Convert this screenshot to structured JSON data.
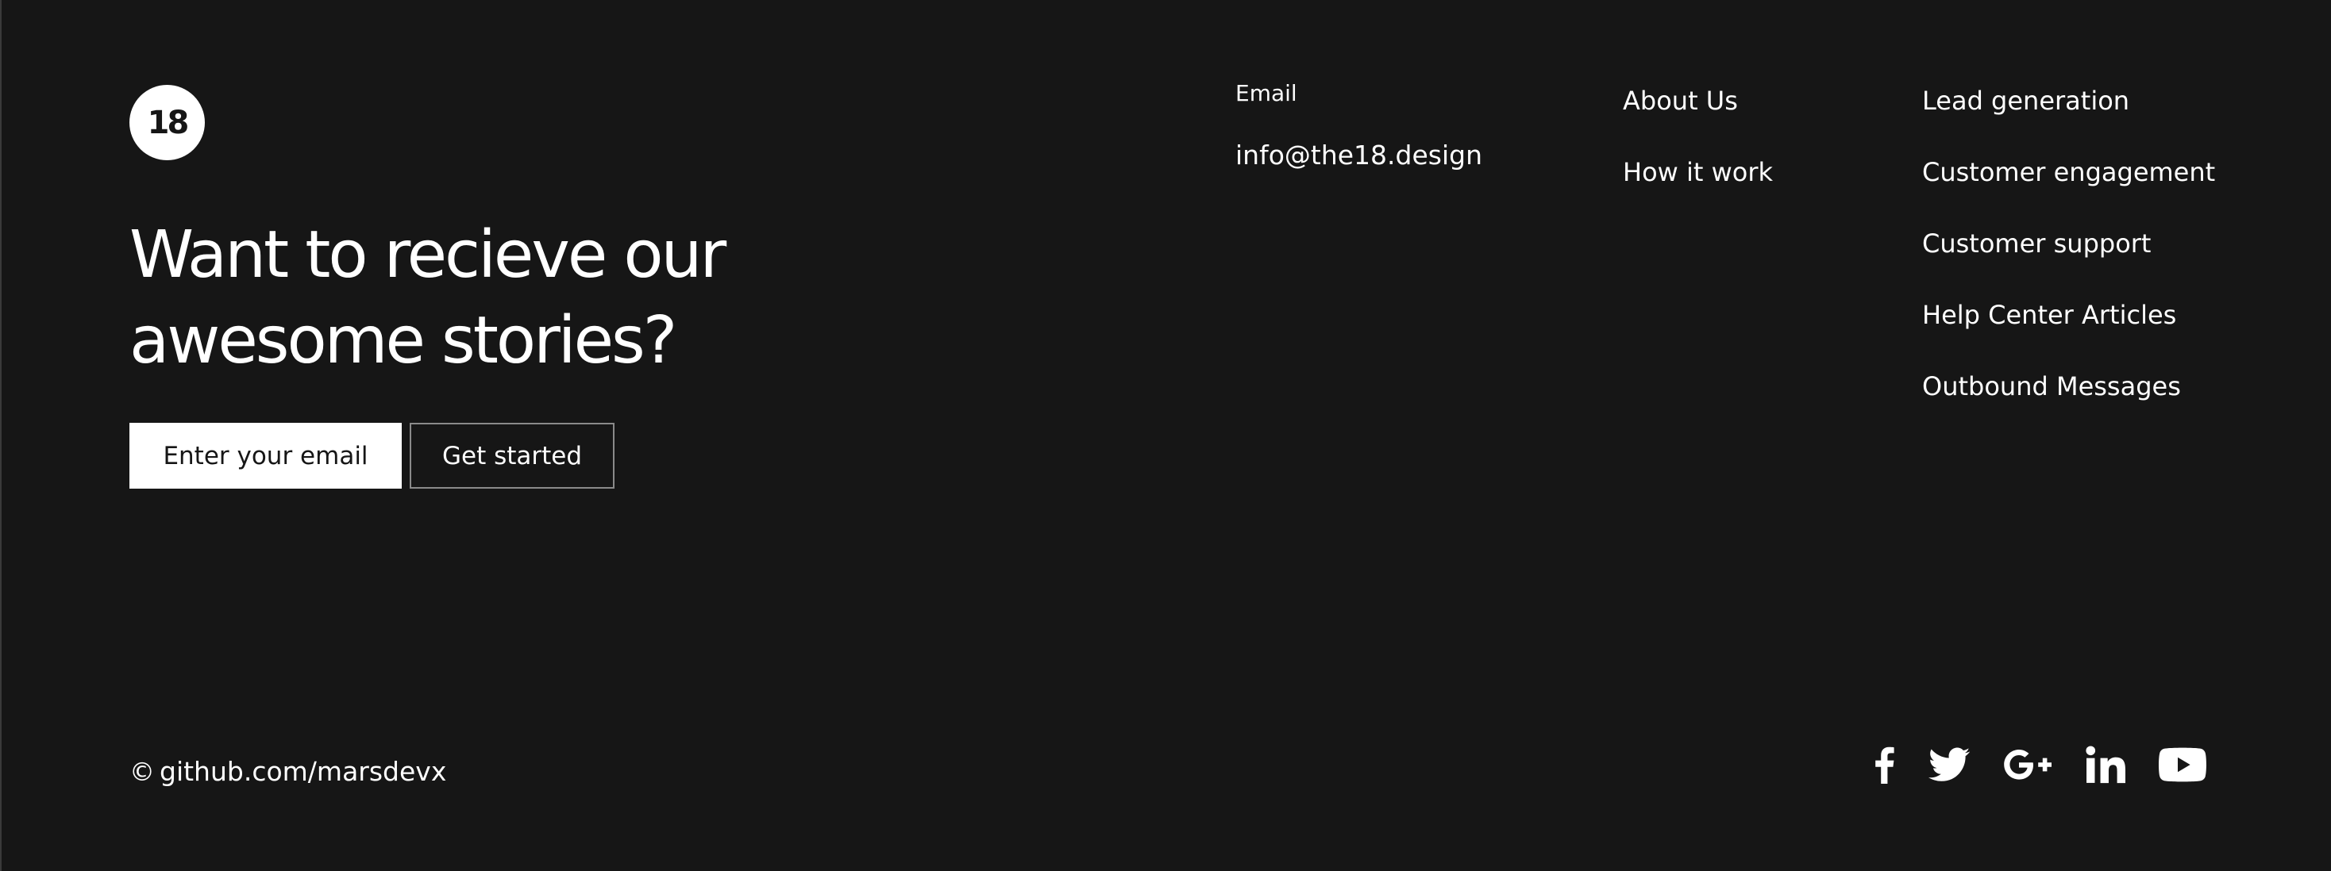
{
  "brand": {
    "logo_text": "18"
  },
  "newsletter": {
    "headline_line1": "Want to recieve our",
    "headline_line2": "awesome stories?",
    "email_placeholder": "Enter your email",
    "button_label": "Get started"
  },
  "contact": {
    "label": "Email",
    "email": "info@the18.design"
  },
  "links": {
    "company": [
      "About Us",
      "How it work"
    ],
    "solutions": [
      "Lead generation",
      "Customer engagement",
      "Customer support",
      "Help Center Articles",
      "Outbound Messages"
    ]
  },
  "footer": {
    "copyright_symbol": "©",
    "copyright_text": "github.com/marsdevx"
  },
  "social": [
    "facebook-icon",
    "twitter-icon",
    "google-plus-icon",
    "linkedin-icon",
    "youtube-icon"
  ],
  "colors": {
    "background": "#161616",
    "text": "#ffffff",
    "button_border": "#8a8a8a"
  }
}
